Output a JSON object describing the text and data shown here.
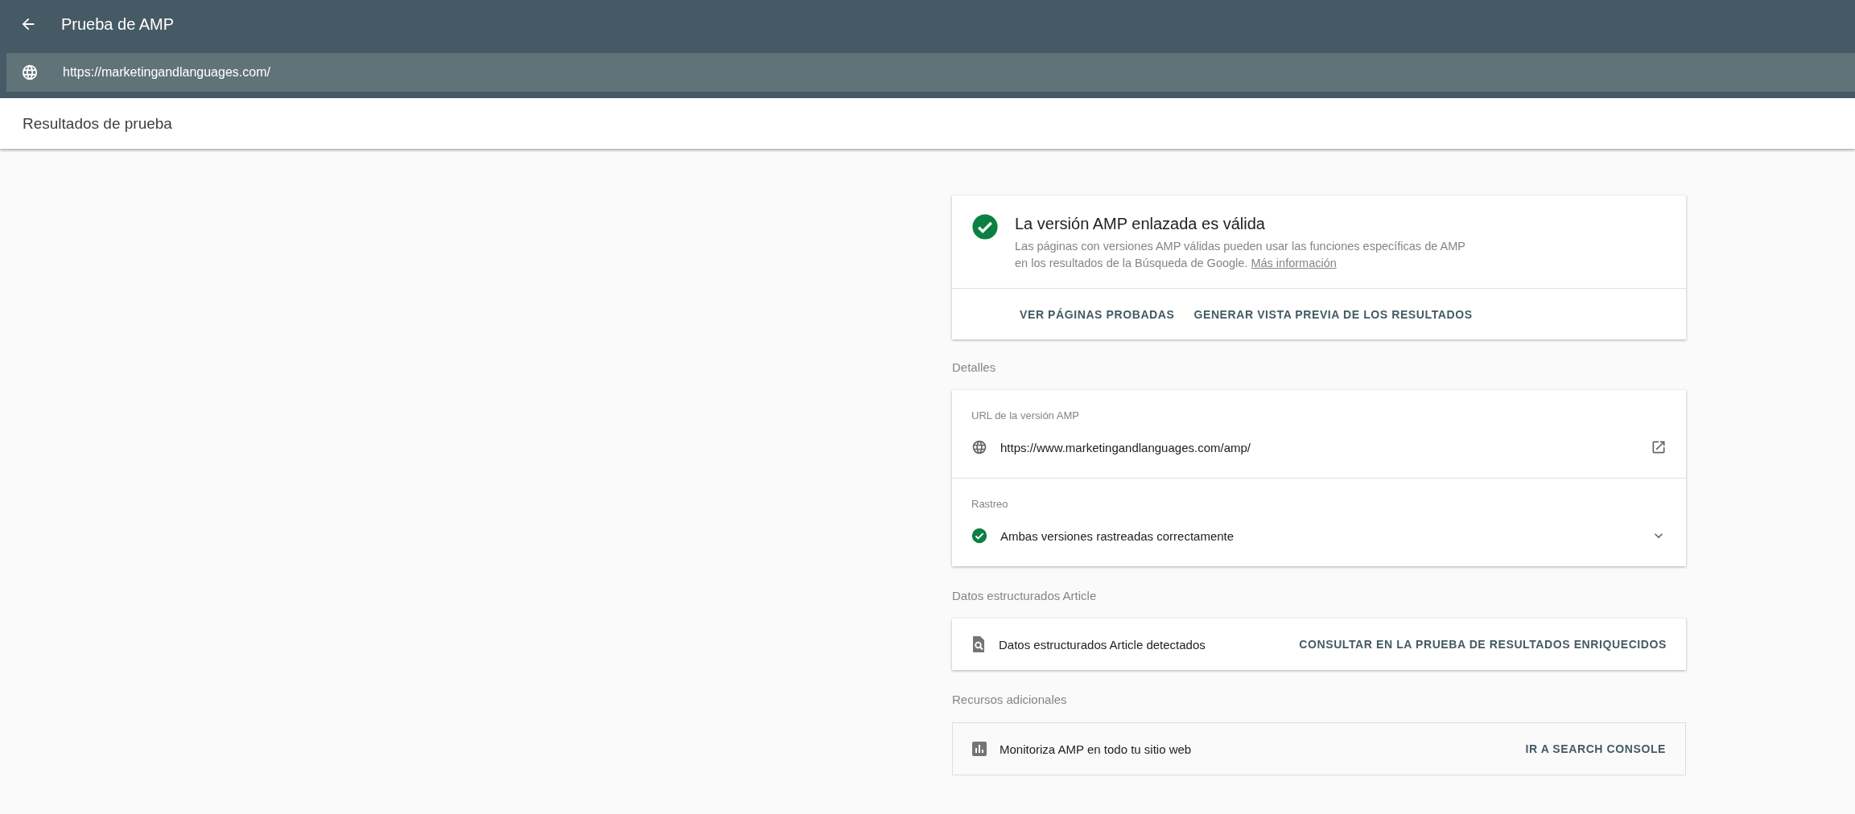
{
  "app_bar": {
    "title": "Prueba de AMP",
    "url": "https://marketingandlanguages.com/"
  },
  "results_bar": {
    "title": "Resultados de prueba"
  },
  "status_card": {
    "title": "La versión AMP enlazada es válida",
    "description": "Las páginas con versiones AMP válidas pueden usar las funciones específicas de AMP en los resultados de la Búsqueda de Google.",
    "link": "Más información",
    "actions": [
      "VER PÁGINAS PROBADAS",
      "GENERAR VISTA PREVIA DE LOS RESULTADOS"
    ]
  },
  "sections": [
    {
      "heading": "Detalles",
      "rows": [
        {
          "label": "URL de la versión AMP",
          "kind": "globe",
          "text": "https://www.marketingandlanguages.com/amp/"
        },
        {
          "label": "Rastreo",
          "kind": "check",
          "text": "Ambas versiones rastreadas correctamente",
          "expanded": false
        }
      ]
    },
    {
      "heading": "Datos estructurados Article",
      "rows": [
        {
          "kind": "doc-search",
          "text": "Datos estructurados Article detectados",
          "action": "CONSULTAR EN LA PRUEBA DE RESULTADOS ENRIQUECIDOS"
        }
      ]
    },
    {
      "heading": "Recursos adicionales",
      "rows": [
        {
          "kind": "chart",
          "text": "Monitoriza AMP en todo tu sitio web",
          "action": "IR A SEARCH CONSOLE"
        }
      ]
    }
  ]
}
